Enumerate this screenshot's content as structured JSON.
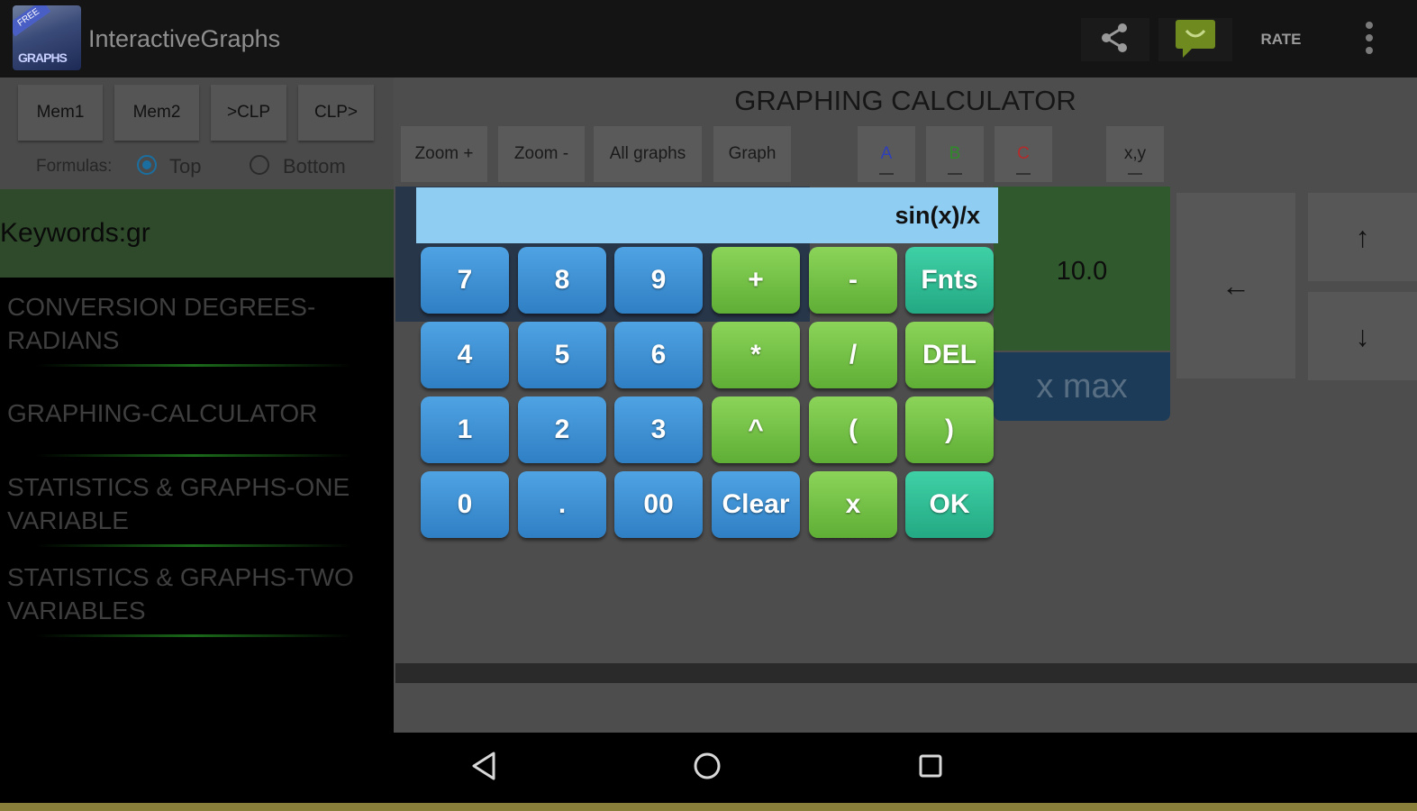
{
  "app": {
    "title": "InteractiveGraphs",
    "logo_banner": "FREE",
    "logo_word": "GRAPHS"
  },
  "actionbar": {
    "share_icon": "share-icon",
    "feedback_icon": "feedback-icon",
    "rate_label": "RATE",
    "overflow_icon": "overflow-menu-icon"
  },
  "left": {
    "mem_buttons": [
      "Mem1",
      "Mem2",
      ">CLP",
      "CLP>"
    ],
    "formulas_label": "Formulas:",
    "radio_top": "Top",
    "radio_bottom": "Bottom",
    "keywords": "Keywords:gr",
    "list": [
      "CONVERSION DEGREES-RADIANS",
      "GRAPHING-CALCULATOR",
      "STATISTICS & GRAPHS-ONE VARIABLE",
      "STATISTICS & GRAPHS-TWO VARIABLES"
    ]
  },
  "main": {
    "title": "GRAPHING CALCULATOR",
    "toolbar": [
      "Zoom +",
      "Zoom -",
      "All graphs",
      "Graph"
    ],
    "color_buttons": [
      {
        "label": "A",
        "color": "#2e3fb8"
      },
      {
        "label": "B",
        "color": "#2f8a2a"
      },
      {
        "label": "C",
        "color": "#b52a2a"
      }
    ],
    "xy_label": "x,y",
    "value": "10.0",
    "xmax_label": "x max",
    "arrows": {
      "left": "←",
      "up": "↑",
      "down": "↓"
    }
  },
  "calculator": {
    "display": "sin(x)/x",
    "keys": [
      [
        "7",
        "8",
        "9",
        "+",
        "-",
        "Fnts"
      ],
      [
        "4",
        "5",
        "6",
        "*",
        "/",
        "DEL"
      ],
      [
        "1",
        "2",
        "3",
        "^",
        "(",
        ")"
      ],
      [
        "0",
        ".",
        "00",
        "Clear",
        "x",
        "OK"
      ]
    ]
  },
  "navbar": {
    "back_icon": "back-icon",
    "home_icon": "home-icon",
    "recents_icon": "recents-icon"
  }
}
